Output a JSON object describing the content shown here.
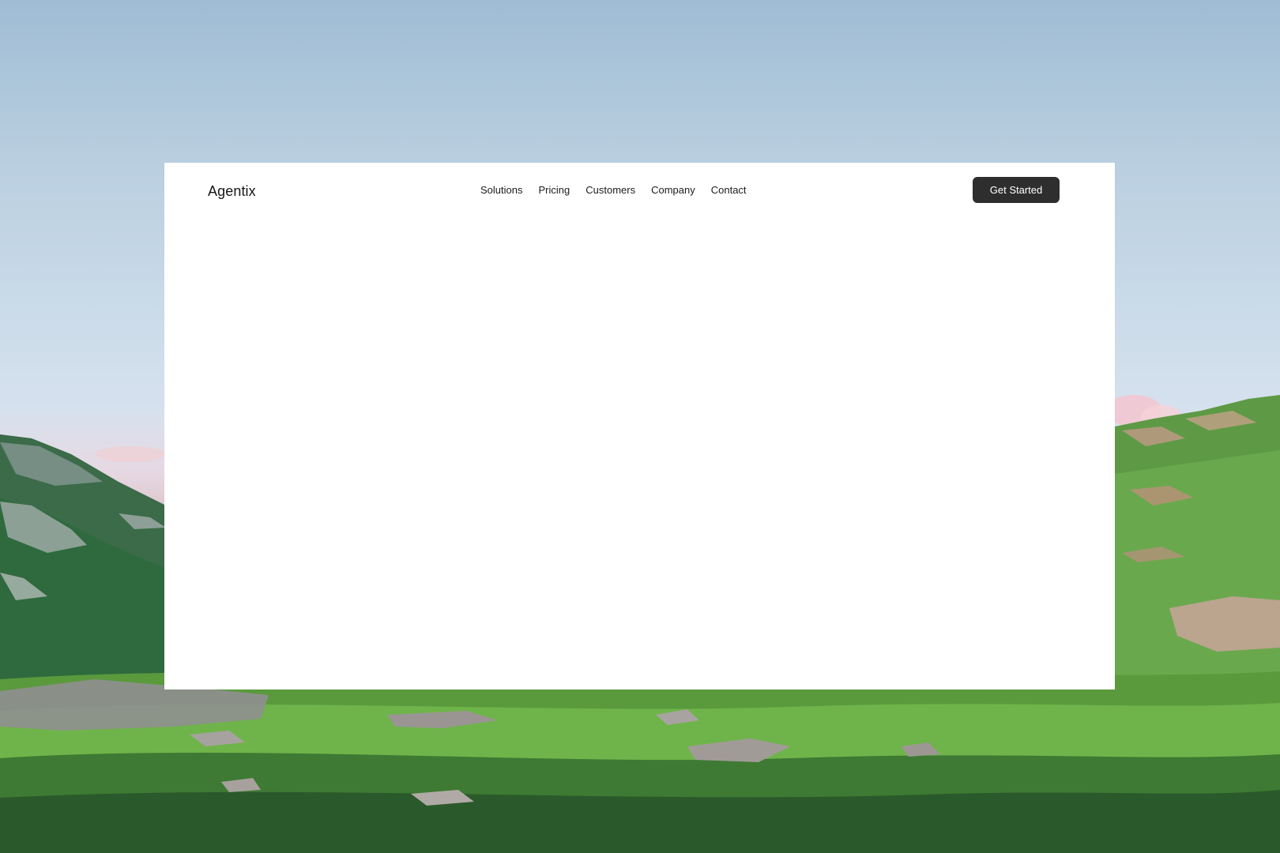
{
  "header": {
    "brand": "Agentix",
    "nav": [
      {
        "label": "Solutions"
      },
      {
        "label": "Pricing"
      },
      {
        "label": "Customers"
      },
      {
        "label": "Company"
      },
      {
        "label": "Contact"
      }
    ],
    "cta_label": "Get Started"
  },
  "colors": {
    "cta_bg": "#2e2e2e",
    "card_bg": "#ffffff",
    "sky": "#c9dae8",
    "grass": "#4f8a3a"
  }
}
